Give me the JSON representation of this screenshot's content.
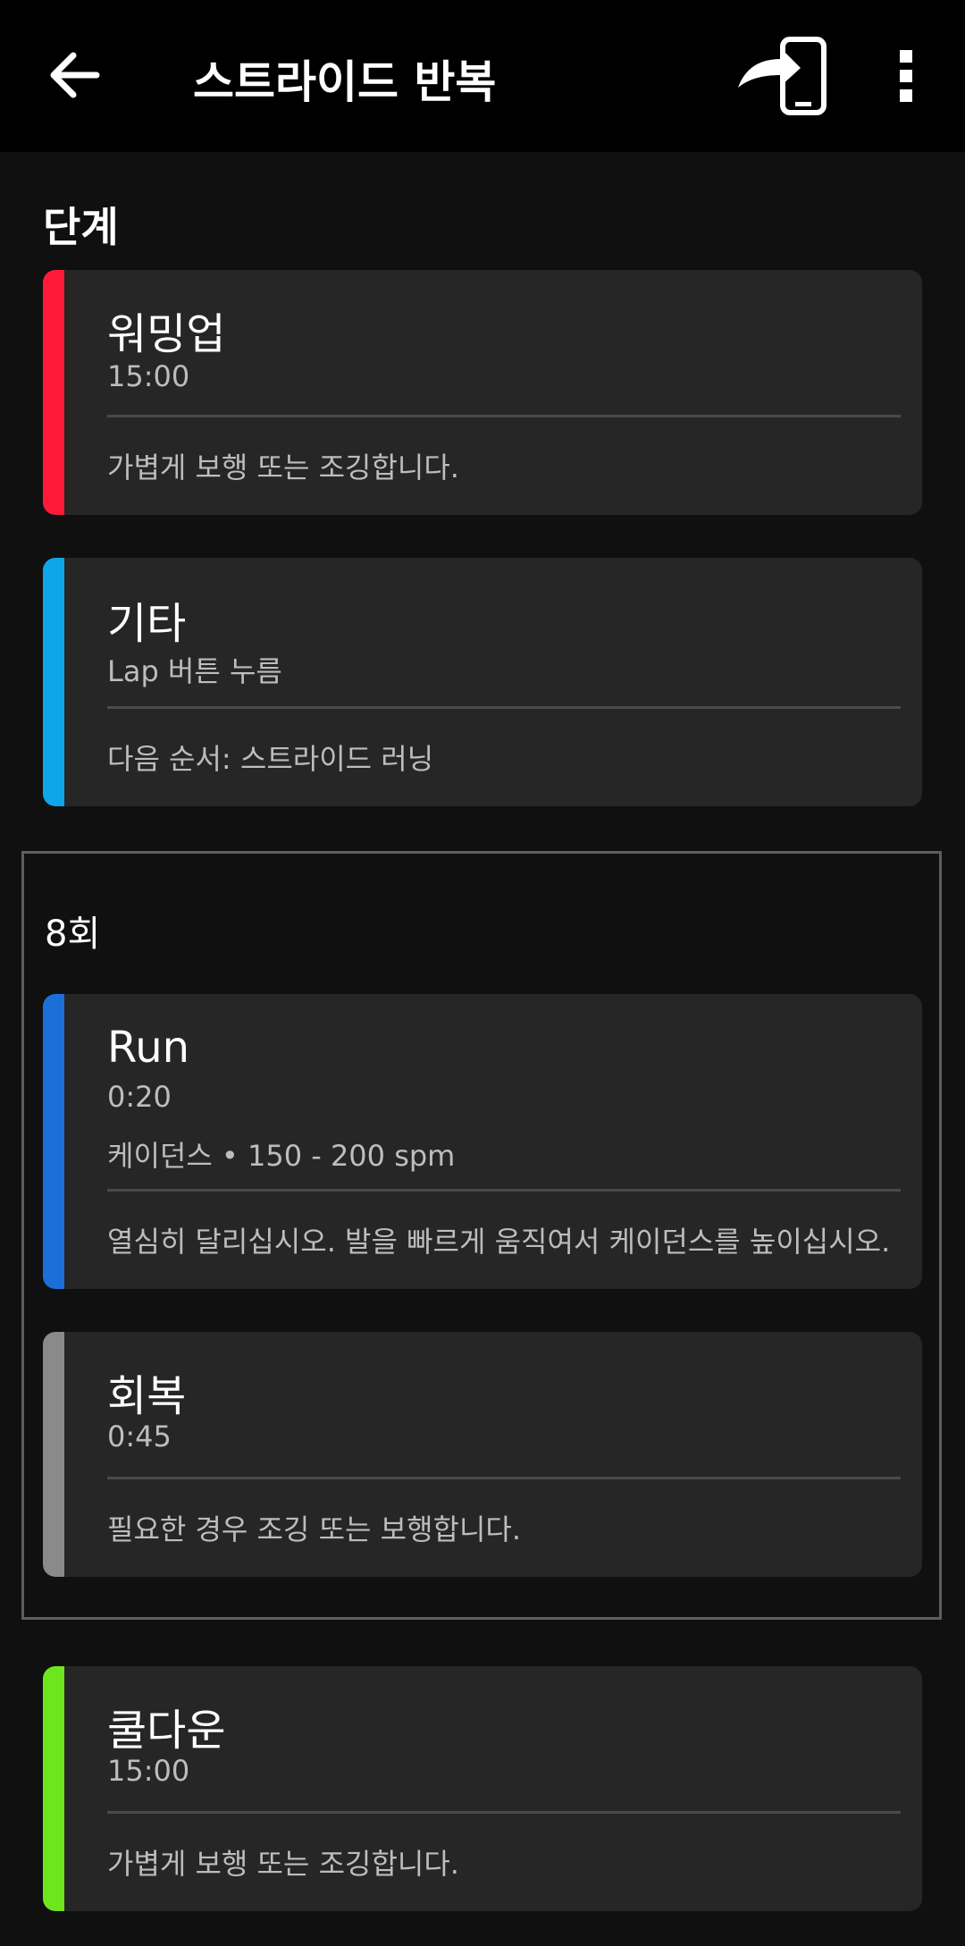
{
  "header": {
    "title": "스트라이드 반복",
    "back_icon": "arrow-left-icon",
    "send_icon": "send-to-device-icon",
    "menu_icon": "more-vertical-icon"
  },
  "section": {
    "title": "단계"
  },
  "steps": {
    "warmup": {
      "name": "워밍업",
      "duration": "15:00",
      "note": "가볍게 보행 또는 조깅합니다.",
      "color": "#ff1a3a"
    },
    "other": {
      "name": "기타",
      "duration": "Lap 버튼 누름",
      "note": "다음 순서: 스트라이드 러닝",
      "color": "#0ea5e9"
    },
    "cooldown": {
      "name": "쿨다운",
      "duration": "15:00",
      "note": "가볍게 보행 또는 조깅합니다.",
      "color": "#6ee61e"
    }
  },
  "repeat": {
    "label": "8회",
    "run": {
      "name": "Run",
      "duration": "0:20",
      "target": "케이던스 • 150 - 200 spm",
      "note": "열심히 달리십시오. 발을 빠르게 움직여서 케이던스를 높이십시오.",
      "color": "#1b6fd6"
    },
    "recovery": {
      "name": "회복",
      "duration": "0:45",
      "note": "필요한 경우 조깅 또는 보행합니다.",
      "color": "#8a8a8a"
    }
  }
}
